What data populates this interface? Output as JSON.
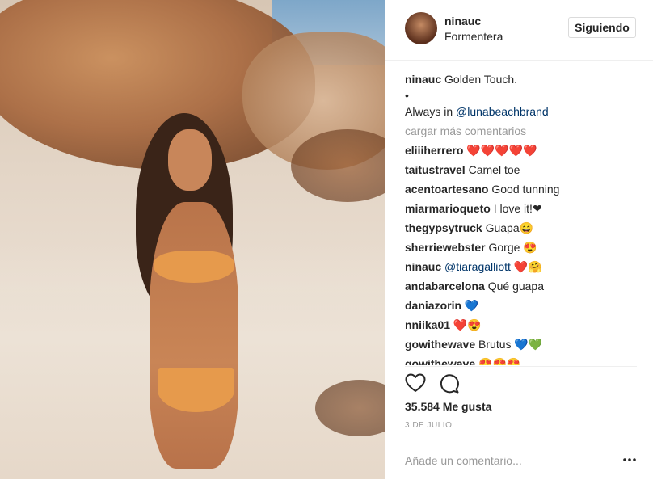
{
  "post": {
    "username": "ninauc",
    "location": "Formentera",
    "follow_label": "Siguiendo",
    "caption_user": "ninauc",
    "caption_text": "Golden Touch.",
    "caption_bullet": "•",
    "caption_line2_prefix": "Always in",
    "caption_mention": "@lunabeachbrand",
    "load_more": "cargar más comentarios",
    "comments": [
      {
        "user": "eliiiherrero",
        "text": "❤️❤️❤️❤️❤️"
      },
      {
        "user": "taitustravel",
        "text": "Camel toe"
      },
      {
        "user": "acentoartesano",
        "text": "Good tunning"
      },
      {
        "user": "miarmarioqueto",
        "text": "I love it!❤"
      },
      {
        "user": "thegypsytruck",
        "text": "Guapa😄"
      },
      {
        "user": "sherriewebster",
        "text": "Gorge 😍"
      },
      {
        "user": "ninauc",
        "mention": "@tiaragalliott",
        "text": "❤️🤗"
      },
      {
        "user": "andabarcelona",
        "text": "Qué guapa"
      },
      {
        "user": "daniazorin",
        "text": "💙"
      },
      {
        "user": "nniika01",
        "text": "❤️😍"
      },
      {
        "user": "gowithewave",
        "text": "Brutus 💙💚"
      },
      {
        "user": "gowithewave",
        "text": "😍😍😍"
      }
    ],
    "likes": "35.584 Me gusta",
    "date": "3 DE JULIO",
    "comment_placeholder": "Añade un comentario..."
  },
  "icons": [
    "heart-icon",
    "comment-icon",
    "more-options-icon"
  ]
}
